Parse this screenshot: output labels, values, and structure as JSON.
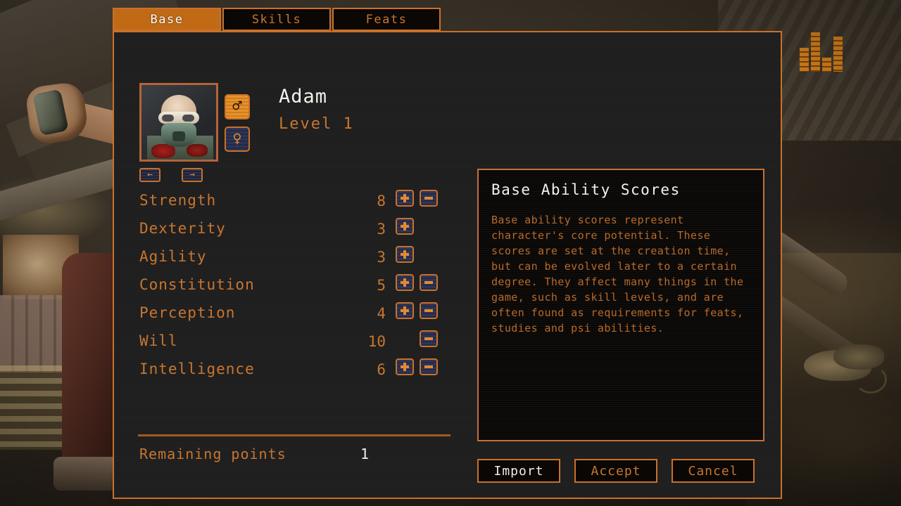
{
  "tabs": [
    {
      "label": "Base",
      "active": true
    },
    {
      "label": "Skills",
      "active": false
    },
    {
      "label": "Feats",
      "active": false
    }
  ],
  "character": {
    "name": "Adam",
    "level": "Level 1",
    "portrait_icon": "character-portrait",
    "prev_arrow": "←",
    "next_arrow": "→",
    "gender": {
      "male_glyph": "♂",
      "female_glyph": "♀",
      "selected": "male"
    }
  },
  "stats": [
    {
      "name": "Strength",
      "value": "8",
      "plus": true,
      "minus": true
    },
    {
      "name": "Dexterity",
      "value": "3",
      "plus": true,
      "minus": false
    },
    {
      "name": "Agility",
      "value": "3",
      "plus": true,
      "minus": false
    },
    {
      "name": "Constitution",
      "value": "5",
      "plus": true,
      "minus": true
    },
    {
      "name": "Perception",
      "value": "4",
      "plus": true,
      "minus": true
    },
    {
      "name": "Will",
      "value": "10",
      "plus": false,
      "minus": true
    },
    {
      "name": "Intelligence",
      "value": "6",
      "plus": true,
      "minus": true
    }
  ],
  "remaining": {
    "label": "Remaining points",
    "value": "1"
  },
  "info": {
    "title": "Base Ability Scores",
    "body": "Base ability scores represent character's core potential. These scores are set at the creation time, but can be evolved later to a certain degree. They affect many things in the game, such as skill levels, and are often found as requirements for feats, studies and psi abilities."
  },
  "actions": [
    {
      "label": "Import",
      "highlight": true
    },
    {
      "label": "Accept",
      "highlight": false
    },
    {
      "label": "Cancel",
      "highlight": false
    }
  ],
  "colors": {
    "accent_orange": "#c8762f",
    "border_orange": "#c9712a",
    "tab_active_bg": "#c06a16",
    "panel_bg": "#1e1e1e",
    "info_bg": "#0a0806",
    "text_light": "#f4f1ec",
    "divider": "#a4591f"
  }
}
